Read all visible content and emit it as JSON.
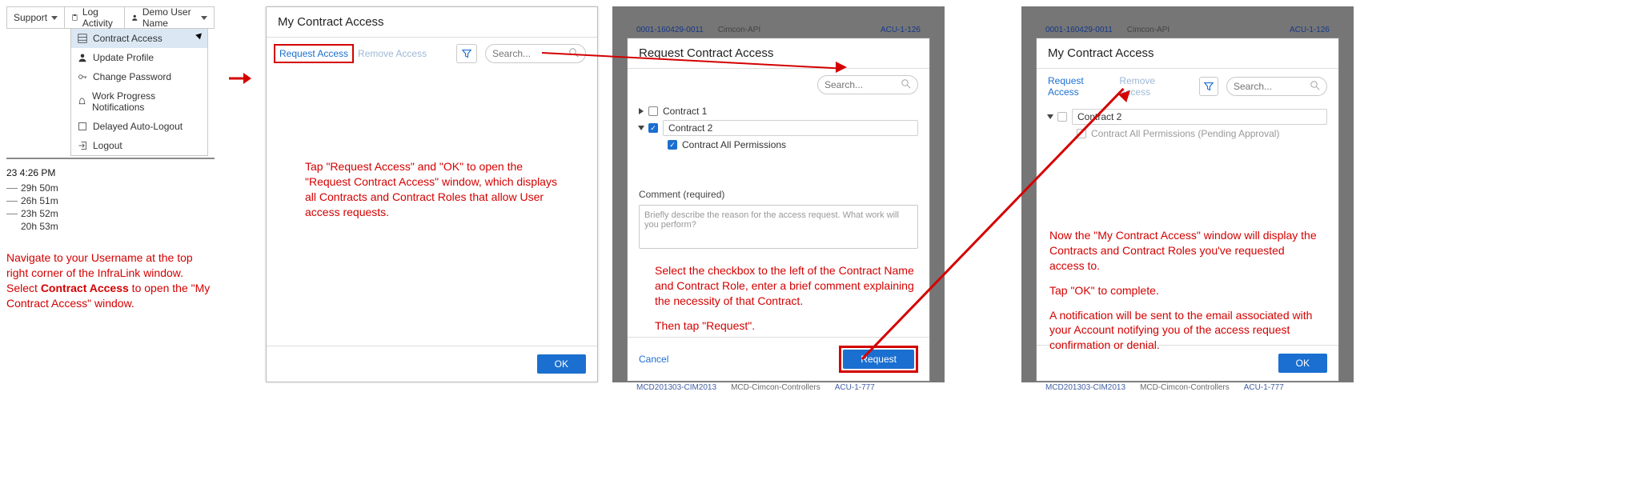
{
  "panel1": {
    "topbar": {
      "support": "Support",
      "log_activity": "Log Activity",
      "username": "Demo User Name"
    },
    "menu": {
      "contract_access": "Contract Access",
      "update_profile": "Update Profile",
      "change_password": "Change Password",
      "work_progress": "Work Progress Notifications",
      "delayed_logout": "Delayed Auto-Logout",
      "logout": "Logout"
    },
    "timestamp": "23 4:26 PM",
    "durations": [
      "29h 50m",
      "26h 51m",
      "23h 52m",
      "20h 53m"
    ],
    "annotation_pre": "Navigate to your Username at the top right corner of the InfraLink window. Select ",
    "annotation_bold": "Contract Access",
    "annotation_post": " to open the \"My Contract Access\" window."
  },
  "panel2": {
    "title": "My Contract Access",
    "request_tab": "Request Access",
    "remove_tab": "Remove Access",
    "search_placeholder": "Search...",
    "ok": "OK",
    "annotation": "Tap \"Request Access\" and \"OK\" to open the \"Request Contract Access\" window, which displays all Contracts and Contract Roles that allow User access requests."
  },
  "panel3": {
    "ghost": {
      "a": "0001-160429-0011",
      "b": "Cimcon-API",
      "c": "ACU-1-126",
      "d": "MCD201303-CIM2013",
      "e": "MCD-Cimcon-Controllers",
      "f": "ACU-1-777"
    },
    "title": "Request Contract Access",
    "search_placeholder": "Search...",
    "contract1": "Contract 1",
    "contract2": "Contract 2",
    "role": "Contract All Permissions",
    "comment_label": "Comment (required)",
    "comment_placeholder": "Briefly describe the reason for the access request. What work will you perform?",
    "cancel": "Cancel",
    "request": "Request",
    "annotation_a": "Select the checkbox to the left of the Contract Name and Contract Role, enter a brief comment explaining the necessity of that Contract.",
    "annotation_b": "Then tap \"Request\"."
  },
  "panel4": {
    "ghost": {
      "a": "0001-160429-0011",
      "b": "Cimcon-API",
      "c": "ACU-1-126",
      "d": "MCD201303-CIM2013",
      "e": "MCD-Cimcon-Controllers",
      "f": "ACU-1-777"
    },
    "title": "My Contract Access",
    "request_tab": "Request Access",
    "remove_tab": "Remove Access",
    "search_placeholder": "Search...",
    "contract2": "Contract 2",
    "role_pending": "Contract All Permissions (Pending Approval)",
    "ok": "OK",
    "annotation_a": "Now the \"My Contract Access\" window will display the Contracts and Contract Roles you've requested access to.",
    "annotation_b": "Tap \"OK\" to complete.",
    "annotation_c": "A notification will be sent to the email associated with your Account notifying you of the access request confirmation or denial."
  }
}
